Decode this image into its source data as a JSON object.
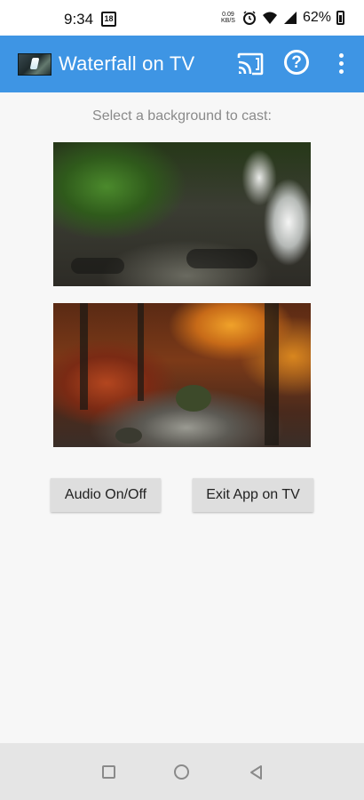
{
  "status_bar": {
    "time": "9:34",
    "calendar_day": "18",
    "speed": [
      "0.09",
      "KB/S"
    ],
    "battery": "62%"
  },
  "app_bar": {
    "title": "Waterfall on TV",
    "icons": [
      "app-logo",
      "cast-icon",
      "help-icon",
      "more-vert-icon"
    ],
    "help_label": "?",
    "color": "#3e95e4"
  },
  "main": {
    "prompt": "Select a background to cast:",
    "backgrounds": [
      {
        "name": "waterfall-background"
      },
      {
        "name": "autumn-forest-stream-background"
      }
    ],
    "buttons": {
      "audio": "Audio On/Off",
      "exit": "Exit App on TV"
    }
  },
  "nav_bar": {
    "icons": [
      "recents-square-icon",
      "home-circle-icon",
      "back-triangle-icon"
    ]
  }
}
